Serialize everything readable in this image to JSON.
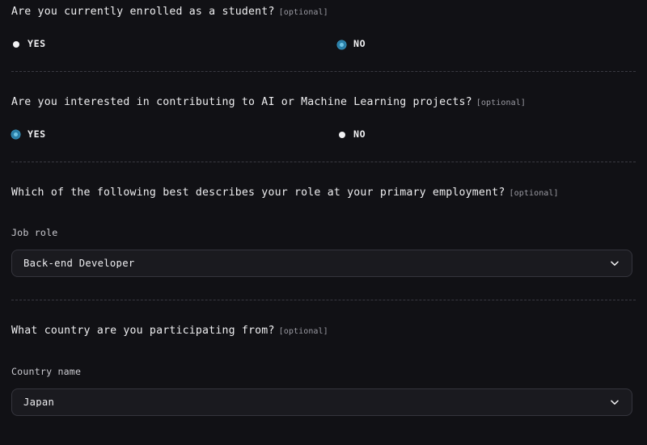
{
  "theme": {
    "background": "#111115",
    "text": "#eeeef0",
    "muted": "#9a9aa2",
    "accent": "#2a7fa8",
    "accent_inner": "#6fc4e4",
    "field_background": "#1a1a1f",
    "field_border": "#35353d",
    "divider": "#3a3a42"
  },
  "optional_tag": "[optional]",
  "chevron_icon": "chevron-down-icon",
  "sections": [
    {
      "id": "student-enrollment",
      "question": "Are you currently enrolled as a student?",
      "options": [
        {
          "label": "YES",
          "selected": false
        },
        {
          "label": "NO",
          "selected": true
        }
      ]
    },
    {
      "id": "ai-ml-interest",
      "question": "Are you interested in contributing to AI or Machine Learning projects?",
      "options": [
        {
          "label": "YES",
          "selected": true
        },
        {
          "label": "NO",
          "selected": false
        }
      ]
    },
    {
      "id": "job-role",
      "question": "Which of the following best describes your role at your primary employment?",
      "field_label": "Job role",
      "value": "Back-end Developer"
    },
    {
      "id": "country",
      "question": "What country are you participating from?",
      "field_label": "Country name",
      "value": "Japan"
    }
  ]
}
